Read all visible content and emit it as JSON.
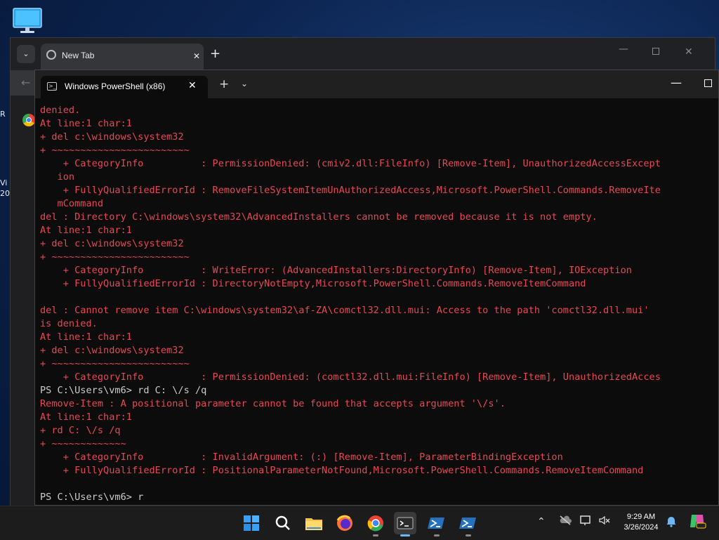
{
  "desktop": {
    "partial_left_text": [
      "R",
      "Vi",
      "20"
    ]
  },
  "chrome": {
    "tab_title": "New Tab"
  },
  "terminal": {
    "tab_title": "Windows PowerShell (x86)",
    "lines": [
      {
        "t": "denied.",
        "s": "err"
      },
      {
        "t": "At line:1 char:1",
        "s": "err"
      },
      {
        "t": "+ del c:\\windows\\system32",
        "s": "err"
      },
      {
        "t": "+ ~~~~~~~~~~~~~~~~~~~~~~~~",
        "s": "err"
      },
      {
        "t": "    + CategoryInfo          : PermissionDenied: (cmiv2.dll:FileInfo) [Remove-Item], UnauthorizedAccessExcept",
        "s": "err"
      },
      {
        "t": "   ion",
        "s": "err"
      },
      {
        "t": "    + FullyQualifiedErrorId : RemoveFileSystemItemUnAuthorizedAccess,Microsoft.PowerShell.Commands.RemoveIte",
        "s": "err"
      },
      {
        "t": "   mCommand",
        "s": "err"
      },
      {
        "t": "del : Directory C:\\windows\\system32\\AdvancedInstallers cannot be removed because it is not empty.",
        "s": "err"
      },
      {
        "t": "At line:1 char:1",
        "s": "err"
      },
      {
        "t": "+ del c:\\windows\\system32",
        "s": "err"
      },
      {
        "t": "+ ~~~~~~~~~~~~~~~~~~~~~~~~",
        "s": "err"
      },
      {
        "t": "    + CategoryInfo          : WriteError: (AdvancedInstallers:DirectoryInfo) [Remove-Item], IOException",
        "s": "err"
      },
      {
        "t": "    + FullyQualifiedErrorId : DirectoryNotEmpty,Microsoft.PowerShell.Commands.RemoveItemCommand",
        "s": "err"
      },
      {
        "t": "",
        "s": "err"
      },
      {
        "t": "del : Cannot remove item C:\\windows\\system32\\af-ZA\\comctl32.dll.mui: Access to the path 'comctl32.dll.mui'",
        "s": "err"
      },
      {
        "t": "is denied.",
        "s": "err"
      },
      {
        "t": "At line:1 char:1",
        "s": "err"
      },
      {
        "t": "+ del c:\\windows\\system32",
        "s": "err"
      },
      {
        "t": "+ ~~~~~~~~~~~~~~~~~~~~~~~~",
        "s": "err"
      },
      {
        "t": "    + CategoryInfo          : PermissionDenied: (comctl32.dll.mui:FileInfo) [Remove-Item], UnauthorizedAcces",
        "s": "err"
      },
      {
        "t": "PS C:\\Users\\vm6> rd C: \\/s /q",
        "s": "norm"
      },
      {
        "t": "Remove-Item : A positional parameter cannot be found that accepts argument '\\/s'.",
        "s": "err"
      },
      {
        "t": "At line:1 char:1",
        "s": "err"
      },
      {
        "t": "+ rd C: \\/s /q",
        "s": "err"
      },
      {
        "t": "+ ~~~~~~~~~~~~~",
        "s": "err"
      },
      {
        "t": "    + CategoryInfo          : InvalidArgument: (:) [Remove-Item], ParameterBindingException",
        "s": "err"
      },
      {
        "t": "    + FullyQualifiedErrorId : PositionalParameterNotFound,Microsoft.PowerShell.Commands.RemoveItemCommand",
        "s": "err"
      },
      {
        "t": "",
        "s": "norm"
      },
      {
        "t": "PS C:\\Users\\vm6> r",
        "s": "norm"
      }
    ]
  },
  "taskbar": {
    "apps": [
      "start-icon",
      "search-icon",
      "file-explorer-icon",
      "firefox-icon",
      "chrome-icon",
      "terminal-icon",
      "powershell-icon",
      "powershell-icon"
    ],
    "time": "9:29 AM",
    "date": "3/26/2024"
  }
}
